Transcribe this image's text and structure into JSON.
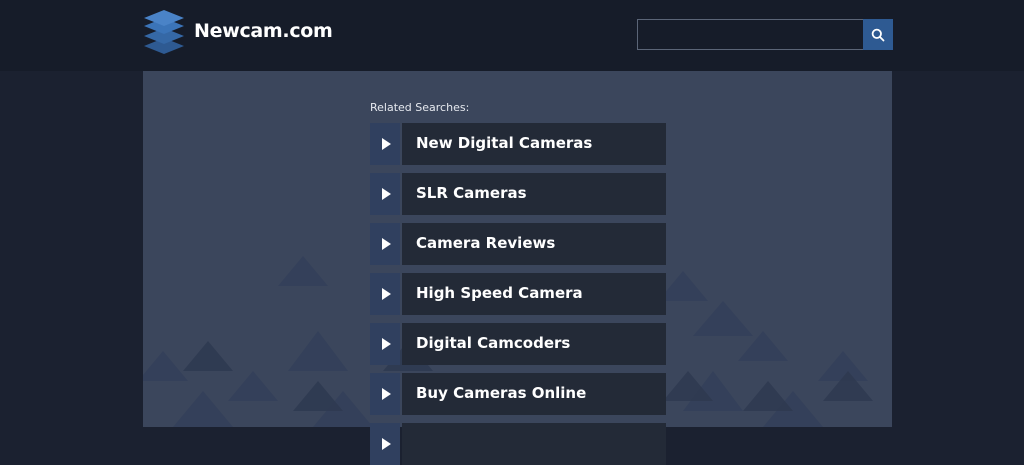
{
  "header": {
    "brand": "Newcam.com",
    "search": {
      "value": "",
      "placeholder": ""
    }
  },
  "main": {
    "related_label": "Related Searches:",
    "links": [
      {
        "label": "New Digital Cameras"
      },
      {
        "label": "SLR Cameras"
      },
      {
        "label": "Camera Reviews"
      },
      {
        "label": "High Speed Camera"
      },
      {
        "label": "Digital Camcoders"
      },
      {
        "label": "Buy Cameras Online"
      },
      {
        "label": ""
      }
    ]
  },
  "colors": {
    "page_bg": "#1b2130",
    "header_bg": "#161c29",
    "panel_bg": "#3b465c",
    "accent": "#2e5a92",
    "link_bg": "#232a37",
    "arrow_bg": "#30405f"
  },
  "icons": {
    "logo": "stacked-layers-icon",
    "search": "search-icon",
    "link_arrow": "play-arrow-icon"
  }
}
